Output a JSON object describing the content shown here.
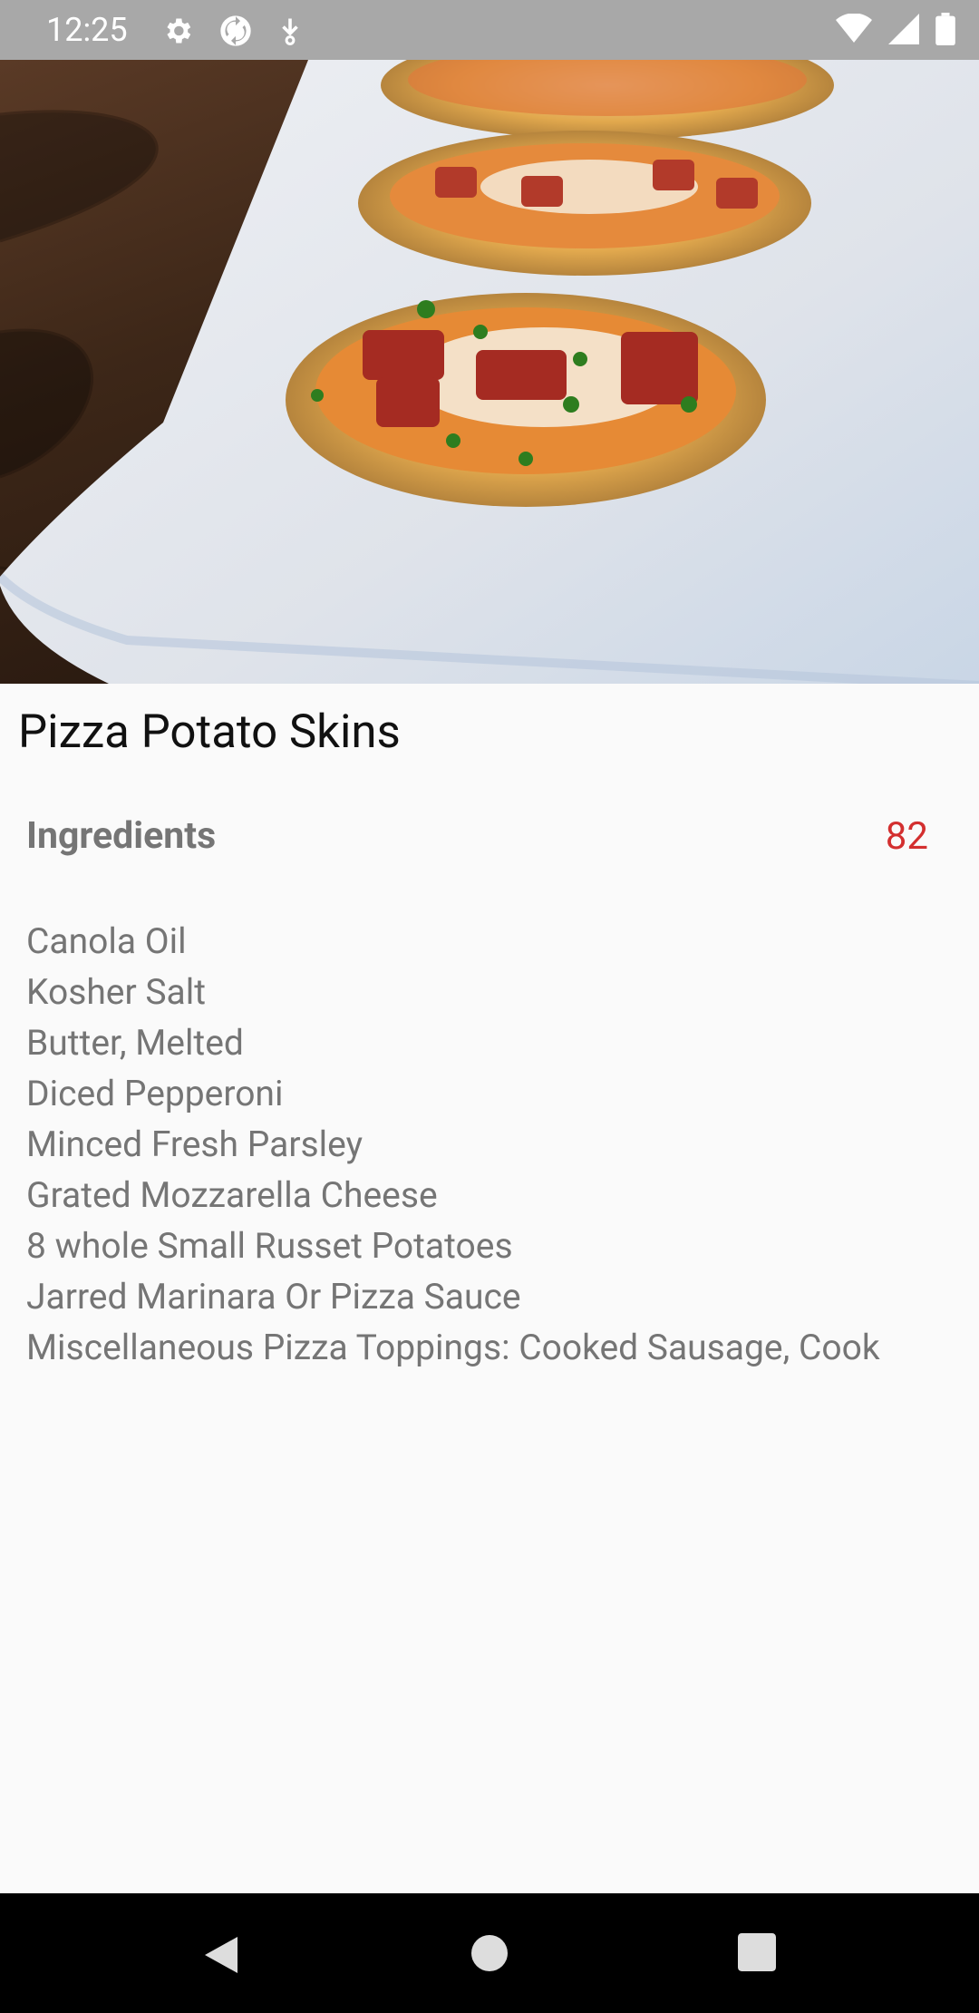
{
  "status_bar": {
    "time": "12:25",
    "left_icons": [
      "gear-icon",
      "sync-icon",
      "download-icon"
    ],
    "right_icons": [
      "wifi-icon",
      "cell-signal-icon",
      "battery-icon"
    ]
  },
  "recipe": {
    "title": "Pizza Potato Skins",
    "ingredients_label": "Ingredients",
    "ingredients_count": "82",
    "ingredients": [
      "Canola Oil",
      "Kosher Salt",
      "Butter, Melted",
      "Diced Pepperoni",
      "Minced Fresh Parsley",
      "Grated Mozzarella Cheese",
      "8 whole Small Russet Potatoes",
      "Jarred Marinara Or Pizza Sauce",
      "Miscellaneous Pizza Toppings: Cooked Sausage, Cook"
    ]
  },
  "nav_bar": {
    "buttons": [
      "back-icon",
      "home-icon",
      "recents-icon"
    ]
  },
  "colors": {
    "accent_count": "#d32f2f",
    "secondary_text": "#757575",
    "status_bar_bg": "#a8a8a8"
  }
}
